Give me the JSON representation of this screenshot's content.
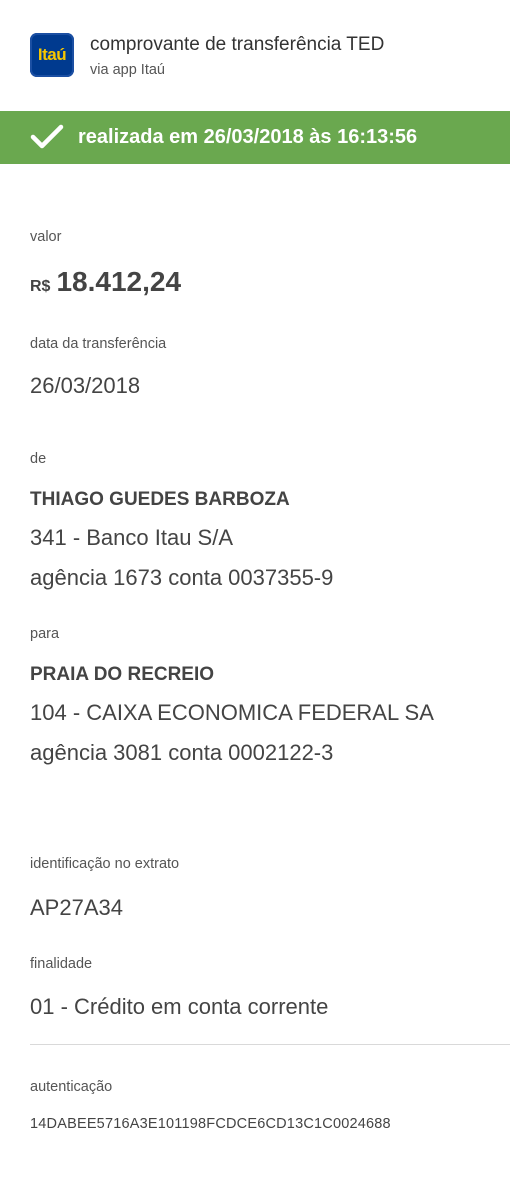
{
  "header": {
    "logo_text": "Itaú",
    "title": "comprovante de transferência TED",
    "subtitle": "via app Itaú"
  },
  "banner": {
    "icon": "check-icon",
    "text": "realizada em 26/03/2018 às 16:13:56",
    "color": "#6aa84f"
  },
  "valor": {
    "label": "valor",
    "currency": "R$",
    "amount": "18.412,24"
  },
  "data_transferencia": {
    "label": "data da transferência",
    "value": "26/03/2018"
  },
  "de": {
    "label": "de",
    "name": "THIAGO GUEDES BARBOZA",
    "bank": "341 - Banco Itau S/A",
    "account": "agência 1673 conta 0037355-9"
  },
  "para": {
    "label": "para",
    "name": "PRAIA DO RECREIO",
    "bank": "104 - CAIXA ECONOMICA FEDERAL SA",
    "account": "agência 3081 conta 0002122-3"
  },
  "identificacao": {
    "label": "identificação no extrato",
    "value": "AP27A34"
  },
  "finalidade": {
    "label": "finalidade",
    "value": "01 - Crédito em conta corrente"
  },
  "autenticacao": {
    "label": "autenticação",
    "value": "14DABEE5716A3E101198FCDCE6CD13C1C0024688"
  }
}
